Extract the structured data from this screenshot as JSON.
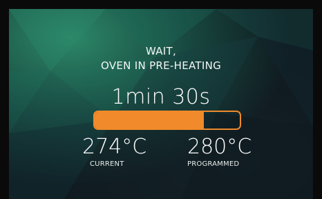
{
  "status": {
    "line1": "WAIT,",
    "line2": "OVEN IN PRE-HEATING"
  },
  "timer": {
    "remaining": "1min 30s"
  },
  "progress": {
    "fraction": 0.75,
    "color": "#f08a2a"
  },
  "temperature": {
    "current_value": "274°C",
    "current_label": "CURRENT",
    "programmed_value": "280°C",
    "programmed_label": "PROGRAMMED"
  }
}
